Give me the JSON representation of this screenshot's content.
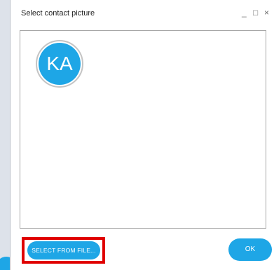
{
  "dialog": {
    "title": "Select contact picture",
    "window_controls": {
      "minimize": "_",
      "maximize": "□",
      "close": "×"
    }
  },
  "avatar": {
    "initials": "KA"
  },
  "buttons": {
    "select_from_file": "SELECT FROM FILE...",
    "ok": "OK"
  },
  "colors": {
    "accent": "#1ea6e6",
    "highlight": "#e00000",
    "border": "#a7a7a7"
  },
  "icons": {
    "minimize": "minimize-icon",
    "maximize": "maximize-icon",
    "close": "close-icon"
  }
}
